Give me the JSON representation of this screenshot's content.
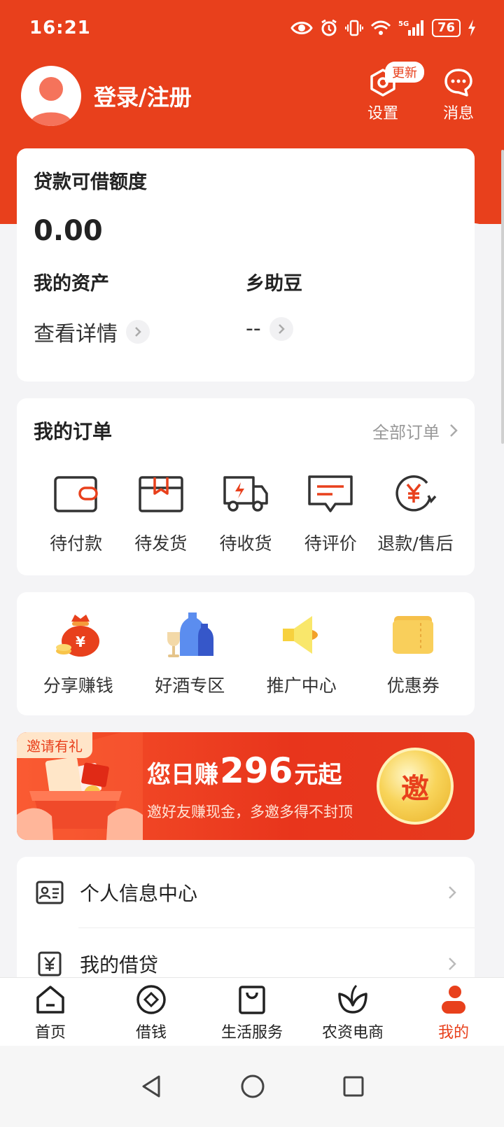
{
  "status_bar": {
    "time": "16:21",
    "battery": "76",
    "network": "5G"
  },
  "header": {
    "login_label": "登录/注册",
    "settings_label": "设置",
    "update_badge": "更新",
    "messages_label": "消息"
  },
  "loan": {
    "title": "贷款可借额度",
    "amount": "0.00",
    "assets_label": "我的资产",
    "assets_link": "查看详情",
    "beans_label": "乡助豆",
    "beans_value": "--"
  },
  "orders": {
    "title": "我的订单",
    "all_label": "全部订单",
    "items": [
      {
        "label": "待付款",
        "icon": "wallet-icon"
      },
      {
        "label": "待发货",
        "icon": "package-icon"
      },
      {
        "label": "待收货",
        "icon": "truck-icon"
      },
      {
        "label": "待评价",
        "icon": "comment-icon"
      },
      {
        "label": "退款/售后",
        "icon": "refund-icon"
      }
    ]
  },
  "services": [
    {
      "label": "分享赚钱",
      "icon": "money-bag-icon"
    },
    {
      "label": "好酒专区",
      "icon": "liquor-icon"
    },
    {
      "label": "推广中心",
      "icon": "megaphone-icon"
    },
    {
      "label": "优惠券",
      "icon": "coupon-icon"
    }
  ],
  "banner": {
    "tag": "邀请有礼",
    "headline_prefix": "您日赚",
    "headline_number": "296",
    "headline_suffix": "元起",
    "subtitle": "邀好友赚现金，多邀多得不封顶",
    "coin_text": "邀"
  },
  "menu": [
    {
      "label": "个人信息中心",
      "icon": "id-card-icon"
    },
    {
      "label": "我的借贷",
      "icon": "yuan-doc-icon"
    }
  ],
  "tabbar": [
    {
      "label": "首页",
      "icon": "home-icon",
      "active": false
    },
    {
      "label": "借钱",
      "icon": "borrow-icon",
      "active": false
    },
    {
      "label": "生活服务",
      "icon": "shopping-bag-icon",
      "active": false
    },
    {
      "label": "农资电商",
      "icon": "leaf-icon",
      "active": false
    },
    {
      "label": "我的",
      "icon": "profile-icon",
      "active": true
    }
  ],
  "colors": {
    "brand": "#e8401c",
    "background": "#f4f4f6"
  }
}
